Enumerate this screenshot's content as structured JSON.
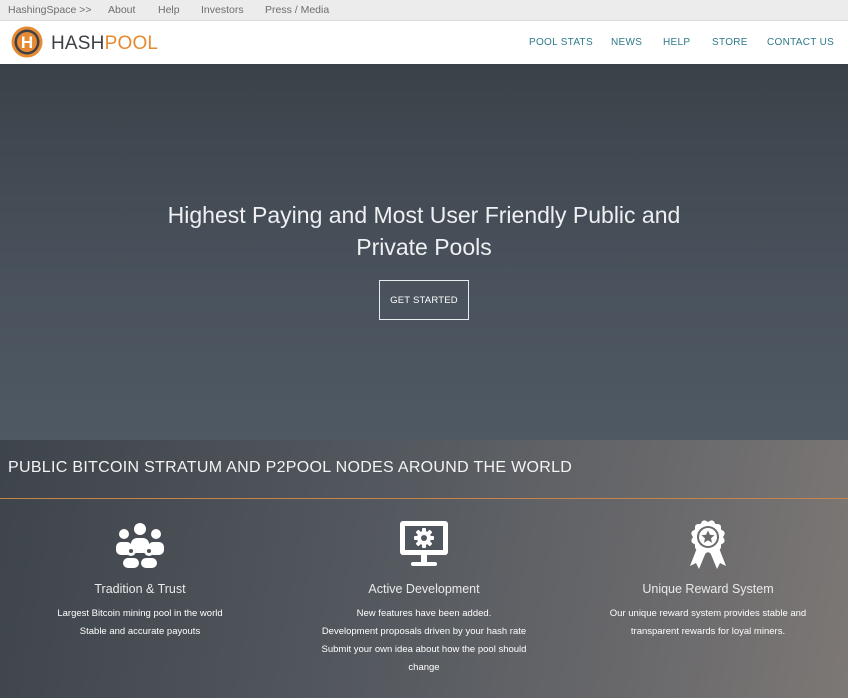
{
  "topbar": {
    "links": [
      "HashingSpace >>",
      "About",
      "Help",
      "Investors",
      "Press / Media"
    ]
  },
  "header": {
    "brand_hash": "HASH",
    "brand_pool": "POOL",
    "logo_letter": "H",
    "nav": [
      "POOL STATS",
      "NEWS",
      "HELP",
      "STORE",
      "CONTACT US"
    ]
  },
  "hero": {
    "title_line1": "Highest Paying and Most User Friendly Public and",
    "title_line2": "Private Pools",
    "cta": "GET STARTED"
  },
  "features": {
    "title": "PUBLIC BITCOIN STRATUM AND P2POOL NODES AROUND THE WORLD",
    "items": [
      {
        "icon": "users-group-icon",
        "title": "Tradition & Trust",
        "lines": [
          "Largest Bitcoin mining pool in the world",
          "Stable and accurate payouts"
        ]
      },
      {
        "icon": "monitor-gear-icon",
        "title": "Active Development",
        "lines": [
          "New features have been added.",
          "Development proposals driven by your hash rate",
          "Submit your own idea about how the pool should",
          "change"
        ]
      },
      {
        "icon": "award-ribbon-icon",
        "title": "Unique Reward System",
        "lines": [
          "Our unique reward system provides stable and",
          "transparent rewards for loyal miners."
        ]
      }
    ]
  },
  "colors": {
    "accent_orange": "#e58a32",
    "nav_teal": "#2d7a8a",
    "logo_dark": "#3d4147"
  }
}
